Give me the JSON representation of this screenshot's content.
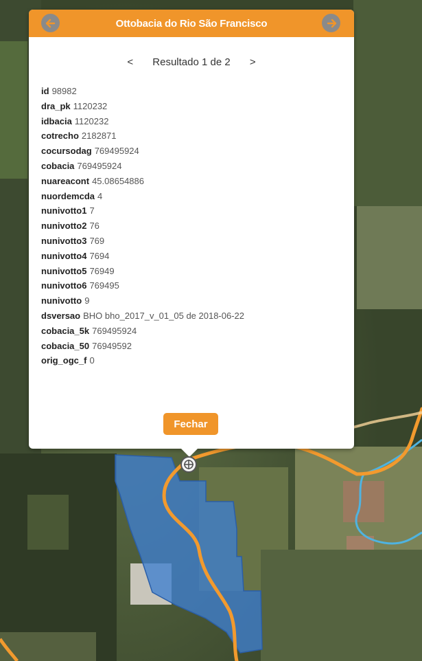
{
  "popup": {
    "title": "Ottobacia do Rio São Francisco",
    "pager": {
      "prev_label": "<",
      "text": "Resultado 1 de 2",
      "next_label": ">"
    },
    "attributes": [
      {
        "key": "id",
        "value": "98982"
      },
      {
        "key": "dra_pk",
        "value": "1120232"
      },
      {
        "key": "idbacia",
        "value": "1120232"
      },
      {
        "key": "cotrecho",
        "value": "2182871"
      },
      {
        "key": "cocursodag",
        "value": "769495924"
      },
      {
        "key": "cobacia",
        "value": "769495924"
      },
      {
        "key": "nuareacont",
        "value": "45.08654886"
      },
      {
        "key": "nuordemcda",
        "value": "4"
      },
      {
        "key": "nunivotto1",
        "value": "7"
      },
      {
        "key": "nunivotto2",
        "value": "76"
      },
      {
        "key": "nunivotto3",
        "value": "769"
      },
      {
        "key": "nunivotto4",
        "value": "7694"
      },
      {
        "key": "nunivotto5",
        "value": "76949"
      },
      {
        "key": "nunivotto6",
        "value": "769495"
      },
      {
        "key": "nunivotto",
        "value": "9"
      },
      {
        "key": "dsversao",
        "value": "BHO bho_2017_v_01_05 de 2018-06-22"
      },
      {
        "key": "cobacia_5k",
        "value": "769495924"
      },
      {
        "key": "cobacia_50",
        "value": "76949592"
      },
      {
        "key": "orig_ogc_f",
        "value": "0"
      }
    ],
    "close_label": "Fechar"
  },
  "colors": {
    "accent": "#f0952a",
    "river_orange": "#f29a2e",
    "river_blue": "#4fb3e0",
    "basin_fill": "#3f7fd0"
  },
  "icons": {
    "prev": "arrow-left-circle-icon",
    "next": "arrow-right-circle-icon",
    "pin": "crosshair-pin-icon"
  }
}
